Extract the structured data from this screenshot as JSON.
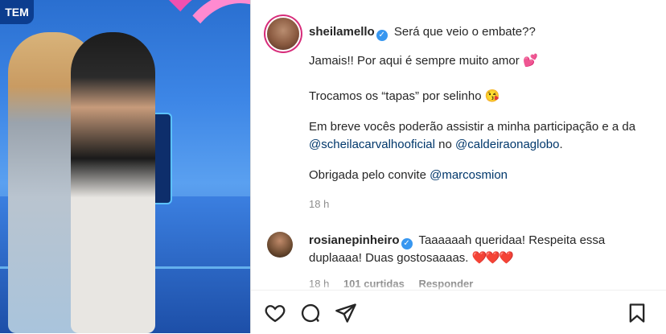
{
  "photo": {
    "logo_text": "TEM"
  },
  "post": {
    "username": "sheilamello",
    "verified_glyph": "✓",
    "lines": [
      "Será que veio o embate??",
      "Jamais!! Por aqui é sempre muito amor",
      "Trocamos os “tapas” por selinho",
      "Em breve vocês poderão assistir a minha participação e a da",
      "@scheilacarvalhooficial",
      "no",
      "@caldeiraonaglobo",
      "Obrigada pelo convite",
      "@marcosmion"
    ],
    "emoji_love": "💕",
    "emoji_kiss": "😘",
    "time": "18 h"
  },
  "comment": {
    "username": "rosianepinheiro",
    "text": "Taaaaaah queridaa! Respeita essa duplaaaa! Duas gostosaaaas.",
    "hearts": "❤️❤️❤️",
    "time": "18 h",
    "likes": "101 curtidas",
    "reply": "Responder"
  },
  "actions": {
    "like_icon": "heart-outline-icon",
    "comment_icon": "comment-bubble-icon",
    "share_icon": "paper-plane-icon",
    "save_icon": "bookmark-icon"
  },
  "colors": {
    "verified": "#3897f0",
    "mention": "#00376b",
    "story_ring": "#d72c7a"
  }
}
